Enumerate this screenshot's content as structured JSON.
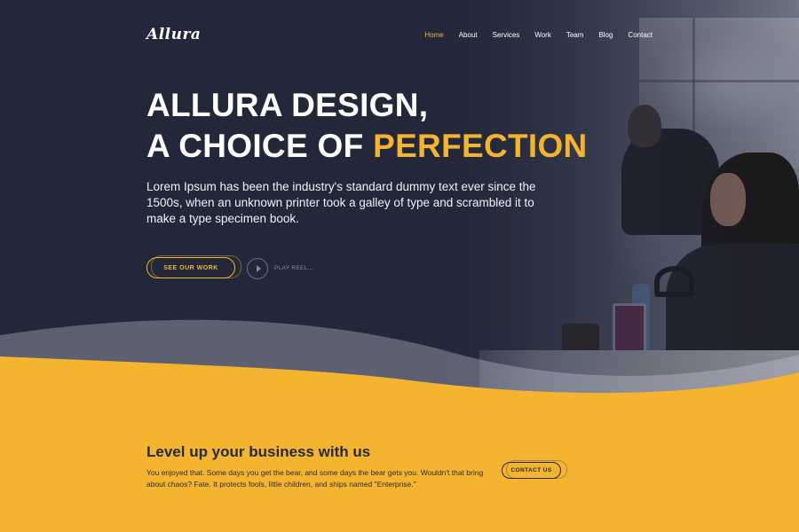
{
  "brand": {
    "logo": "Allura"
  },
  "nav": {
    "items": [
      {
        "label": "Home",
        "active": true
      },
      {
        "label": "About",
        "active": false
      },
      {
        "label": "Services",
        "active": false
      },
      {
        "label": "Work",
        "active": false
      },
      {
        "label": "Team",
        "active": false
      },
      {
        "label": "Blog",
        "active": false
      },
      {
        "label": "Contact",
        "active": false
      }
    ]
  },
  "hero": {
    "headline_line1": "ALLURA DESIGN,",
    "headline_line2_prefix": "A CHOICE OF",
    "headline_line2_accent": "PERFECTION",
    "lead": "Lorem Ipsum has been the industry's standard dummy text ever since the 1500s, when an unknown printer took a galley of type and scrambled it to make a type specimen book.",
    "cta_label": "SEE OUR WORK",
    "play_label": "PLAY REEL..."
  },
  "cta": {
    "title": "Level up your business with us",
    "text": "You enjoyed that. Some days you get the bear, and some days the bear gets you. Wouldn't that bring about chaos? Fate. It protects fools, little children, and ships named \"Enterprise.\"",
    "button_label": "CONTACT US"
  },
  "colors": {
    "accent": "#f4b42f",
    "dark": "#23273a"
  },
  "icons": {
    "play": "play-icon"
  }
}
